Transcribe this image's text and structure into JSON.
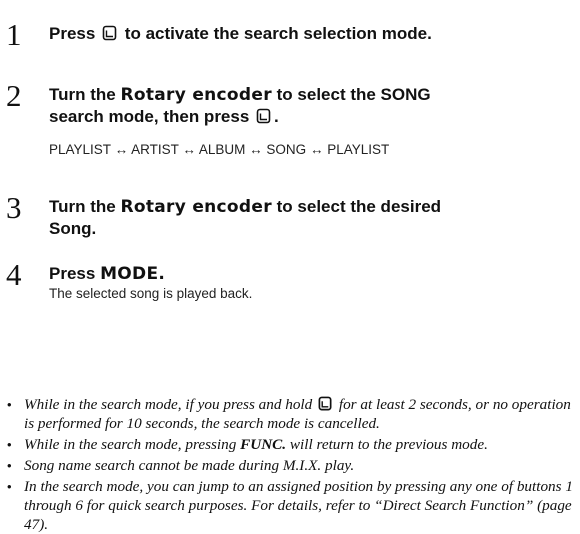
{
  "steps": [
    {
      "number": "1",
      "title_before": "Press",
      "title_after": "to activate the search selection mode."
    },
    {
      "number": "2",
      "title_line1_before": "Turn the",
      "title_line1_key": "Rotary encoder",
      "title_line1_after": "to select the SONG",
      "title_line2_before": "search mode, then press",
      "title_line2_after": ".",
      "sequence": [
        "PLAYLIST",
        "↔",
        "ARTIST",
        "↔",
        "ALBUM",
        "↔",
        "SONG",
        "↔",
        "PLAYLIST"
      ]
    },
    {
      "number": "3",
      "title_line1_before": "Turn the",
      "title_line1_key": "Rotary encoder",
      "title_line1_after": "to select the desired",
      "title_line2": "Song."
    },
    {
      "number": "4",
      "title_before": "Press",
      "title_key": "MODE.",
      "subtitle": "The selected song is played back."
    }
  ],
  "notes": {
    "bullet": "•",
    "n1_before": "While in the search mode, if you press and hold",
    "n1_after": "for at least 2 seconds, or no operation is performed for 10 seconds, the search mode is cancelled.",
    "n2_before": "While in the search mode, pressing",
    "n2_key": "FUNC.",
    "n2_after": "will return to the previous mode.",
    "n3": "Song name search cannot be made during M.I.X. play.",
    "n4": "In the search mode, you can jump to an assigned position by pressing any one of  buttons 1 through 6 for quick search purposes. For details, refer to “Direct Search Function” (page 47)."
  }
}
